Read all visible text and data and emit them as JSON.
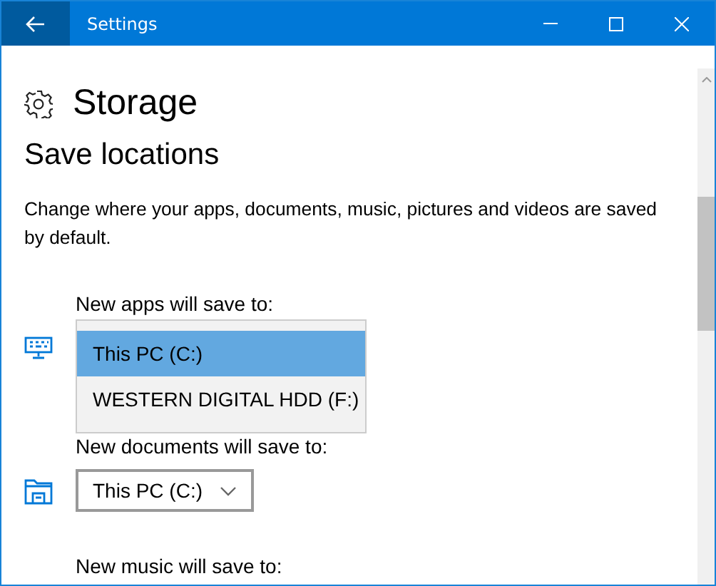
{
  "window": {
    "title": "Settings"
  },
  "page": {
    "title": "Storage"
  },
  "section": {
    "title": "Save locations",
    "description": "Change where your apps, documents, music, pictures and videos are saved by default."
  },
  "locations": [
    {
      "label": "New apps will save to:",
      "options": [
        {
          "label": "This PC (C:)",
          "selected": true
        },
        {
          "label": "WESTERN DIGITAL HDD (F:)",
          "selected": false
        }
      ]
    },
    {
      "label": "New documents will save to:",
      "value": "This PC (C:)"
    },
    {
      "label": "New music will save to:"
    }
  ]
}
